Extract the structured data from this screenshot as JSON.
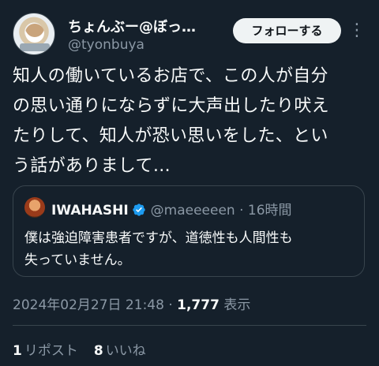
{
  "author": {
    "display_name": "ちょんぶー@ぼっ…",
    "handle": "@tyonbuya",
    "follow_label": "フォローする",
    "more_label": "⋮"
  },
  "tweet": {
    "text": "知人の働いているお店で、この人が自分\nの思い通りにならずに大声出したり吠え\nたりして、知人が恐い思いをした、とい\nう話がありまして…"
  },
  "quote": {
    "name": "IWAHASHI",
    "handle_time": "@maeeeeen · 16時間",
    "text": "僕は強迫障害患者ですが、道徳性も人間性も\n失っていません。"
  },
  "meta": {
    "timestamp": "2024年02月27日 21:48 · ",
    "views_count": "1,777",
    "views_label": " 表示"
  },
  "stats": {
    "retweets_count": "1",
    "retweets_label": "リポスト",
    "likes_count": "8",
    "likes_label": "いいね"
  },
  "colors": {
    "background": "#15202b",
    "text": "#f7f9f9",
    "secondary": "#8b98a5",
    "border": "#38444d",
    "verified": "#1d9bf0"
  }
}
